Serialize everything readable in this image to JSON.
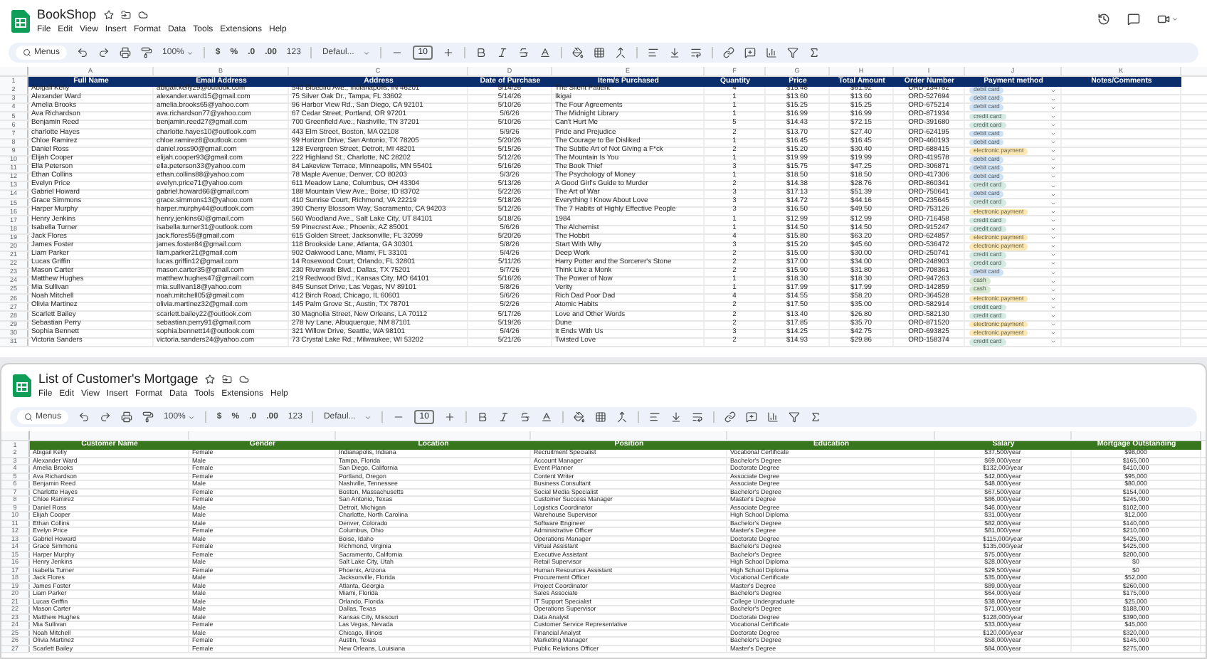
{
  "windows": [
    {
      "title": "BookShop",
      "menu": [
        "File",
        "Edit",
        "View",
        "Insert",
        "Format",
        "Data",
        "Tools",
        "Extensions",
        "Help"
      ],
      "toolbar": {
        "search": "Menus",
        "zoom": "100%",
        "font": "Defaul...",
        "font_size": "10",
        "currency": "$",
        "percent": "%",
        "decrease_decimals": ".0",
        "increase_decimals": ".00",
        "number_format": "123"
      },
      "sheet": {
        "kind": "orders",
        "column_letters": [
          "A",
          "B",
          "C",
          "D",
          "E",
          "F",
          "G",
          "H",
          "I",
          "J",
          "K"
        ],
        "columns": [
          "Full Name",
          "Email Address",
          "Address",
          "Date of Purchase",
          "Item/s Purchased",
          "Quantity",
          "Price",
          "Total Amount",
          "Order Number",
          "Payment method",
          "Notes/Comments"
        ],
        "header_row_number": "1",
        "rows": [
          {
            "row_number": "2",
            "cells": [
              "Abigail Kelly",
              "abigail.kelly29@outlook.com",
              "540 Bluebird Ave., Indianapolis, IN 46201",
              "5/14/26",
              "The Silent Patient",
              "4",
              "$15.48",
              "$61.92",
              "ORD-134782"
            ],
            "payment": {
              "label": "debit card",
              "color": "#cfe2f3"
            }
          },
          {
            "row_number": "3",
            "cells": [
              "Alexander Ward",
              "alexander.ward15@gmail.com",
              "75 Silver Oak Dr., Tampa, FL 33602",
              "5/14/26",
              "Ikigai",
              "1",
              "$13.60",
              "$13.60",
              "ORD-527694"
            ],
            "payment": {
              "label": "debit card",
              "color": "#cfe2f3"
            }
          },
          {
            "row_number": "4",
            "cells": [
              "Amelia Brooks",
              "amelia.brooks65@yahoo.com",
              "96 Harbor View Rd., San Diego, CA 92101",
              "5/10/26",
              "The Four Agreements",
              "1",
              "$15.25",
              "$15.25",
              "ORD-675214"
            ],
            "payment": {
              "label": "debit card",
              "color": "#cfe2f3"
            }
          },
          {
            "row_number": "5",
            "cells": [
              "Ava Richardson",
              "ava.richardson77@yahoo.com",
              "67 Cedar Street, Portland, OR 97201",
              "5/6/26",
              "The Midnight Library",
              "1",
              "$16.99",
              "$16.99",
              "ORD-871934"
            ],
            "payment": {
              "label": "credit card",
              "color": "#d4ebe4"
            }
          },
          {
            "row_number": "6",
            "cells": [
              "Benjamin Reed",
              "benjamin.reed27@gmail.com",
              "700 Greenfield Ave., Nashville, TN 37201",
              "5/10/26",
              "Can't Hurt Me",
              "5",
              "$14.43",
              "$72.15",
              "ORD-391680"
            ],
            "payment": {
              "label": "credit card",
              "color": "#d4ebe4"
            }
          },
          {
            "row_number": "7",
            "cells": [
              "charlotte Hayes",
              "charlotte.hayes10@outlook.com",
              "443 Elm Street, Boston, MA 02108",
              "5/9/26",
              "Pride and Prejudice",
              "2",
              "$13.70",
              "$27.40",
              "ORD-624195"
            ],
            "payment": {
              "label": "debit card",
              "color": "#cfe2f3"
            }
          },
          {
            "row_number": "8",
            "cells": [
              "Chloe Ramirez",
              "chloe.ramirez8@outlook.com",
              "99 Horizon Drive, San Antonio, TX 78205",
              "5/20/26",
              "The Courage to Be Disliked",
              "1",
              "$16.45",
              "$16.45",
              "ORD-460193"
            ],
            "payment": {
              "label": "debit card",
              "color": "#cfe2f3"
            }
          },
          {
            "row_number": "9",
            "cells": [
              "Daniel Ross",
              "daniel.ross90@gmail.com",
              "128 Evergreen Street, Detroit, MI 48201",
              "5/15/26",
              "The Subtle Art of Not Giving a F*ck",
              "2",
              "$15.20",
              "$30.40",
              "ORD-688415"
            ],
            "payment": {
              "label": "electronic payment",
              "color": "#fce8b2"
            }
          },
          {
            "row_number": "10",
            "cells": [
              "Elijah Cooper",
              "elijah.cooper93@gmail.com",
              "222 Highland St., Charlotte, NC 28202",
              "5/12/26",
              "The Mountain Is You",
              "1",
              "$19.99",
              "$19.99",
              "ORD-419578"
            ],
            "payment": {
              "label": "debit card",
              "color": "#cfe2f3"
            }
          },
          {
            "row_number": "11",
            "cells": [
              "Ella Peterson",
              "ella.peterson33@yahoo.com",
              "84 Lakeview Terrace, Minneapolis, MN 55401",
              "5/16/26",
              "The Book Thief",
              "3",
              "$15.75",
              "$47.25",
              "ORD-306871"
            ],
            "payment": {
              "label": "debit card",
              "color": "#cfe2f3"
            }
          },
          {
            "row_number": "12",
            "cells": [
              "Ethan Collins",
              "ethan.collins88@yahoo.com",
              "78 Maple Avenue, Denver, CO 80203",
              "5/3/26",
              "The Psychology of Money",
              "1",
              "$18.50",
              "$18.50",
              "ORD-417306"
            ],
            "payment": {
              "label": "debit card",
              "color": "#cfe2f3"
            }
          },
          {
            "row_number": "13",
            "cells": [
              "Evelyn Price",
              "evelyn.price71@yahoo.com",
              "611 Meadow Lane, Columbus, OH 43304",
              "5/13/26",
              "A Good Girl's Guide to Murder",
              "2",
              "$14.38",
              "$28.76",
              "ORD-860341"
            ],
            "payment": {
              "label": "credit card",
              "color": "#d4ebe4"
            }
          },
          {
            "row_number": "14",
            "cells": [
              "Gabriel Howard",
              "gabriel.howard66@gmail.com",
              "188 Mountain View Ave., Boise, ID 83702",
              "5/22/26",
              "The Art of War",
              "3",
              "$17.13",
              "$51.39",
              "ORD-750641"
            ],
            "payment": {
              "label": "debit card",
              "color": "#cfe2f3"
            }
          },
          {
            "row_number": "15",
            "cells": [
              "Grace Simmons",
              "grace.simmons13@yahoo.com",
              "410 Sunrise Court, Richmond, VA 22219",
              "5/18/26",
              "Everything I Know About Love",
              "3",
              "$14.72",
              "$44.16",
              "ORD-235645"
            ],
            "payment": {
              "label": "credit card",
              "color": "#d4ebe4"
            }
          },
          {
            "row_number": "16",
            "cells": [
              "Harper Murphy",
              "harper.murphy44@outlook.com",
              "390 Cherry Blossom Way, Sacramento, CA 94203",
              "5/12/26",
              "The 7 Habits of Highly Effective People",
              "3",
              "$16.50",
              "$49.50",
              "ORD-753126"
            ],
            "payment": {
              "label": "electronic payment",
              "color": "#fce8b2"
            }
          },
          {
            "row_number": "17",
            "cells": [
              "Henry Jenkins",
              "henry.jenkins60@gmail.com",
              "560 Woodland Ave., Salt Lake City, UT 84101",
              "5/18/26",
              "1984",
              "1",
              "$12.99",
              "$12.99",
              "ORD-716458"
            ],
            "payment": {
              "label": "credit card",
              "color": "#d4ebe4"
            }
          },
          {
            "row_number": "18",
            "cells": [
              "Isabella Turner",
              "isabella.turner31@outlook.com",
              "59 Pinecrest Ave., Phoenix, AZ 85001",
              "5/6/26",
              "The Alchemist",
              "1",
              "$14.50",
              "$14.50",
              "ORD-915247"
            ],
            "payment": {
              "label": "credit card",
              "color": "#d4ebe4"
            }
          },
          {
            "row_number": "19",
            "cells": [
              "Jack Flores",
              "jack.flores55@gmail.com",
              "615 Golden Street, Jacksonville, FL 32099",
              "5/20/26",
              "The Hobbit",
              "4",
              "$15.80",
              "$63.20",
              "ORD-624857"
            ],
            "payment": {
              "label": "electronic payment",
              "color": "#fce8b2"
            }
          },
          {
            "row_number": "20",
            "cells": [
              "James Foster",
              "james.foster84@gmail.com",
              "118 Brookside Lane, Atlanta, GA 30301",
              "5/8/26",
              "Start With Why",
              "3",
              "$15.20",
              "$45.60",
              "ORD-536472"
            ],
            "payment": {
              "label": "electronic payment",
              "color": "#fce8b2"
            }
          },
          {
            "row_number": "21",
            "cells": [
              "Liam Parker",
              "liam.parker21@gmail.com",
              "902 Oakwood Lane, Miami, FL 33101",
              "5/4/26",
              "Deep Work",
              "2",
              "$15.00",
              "$30.00",
              "ORD-250741"
            ],
            "payment": {
              "label": "credit card",
              "color": "#d4ebe4"
            }
          },
          {
            "row_number": "22",
            "cells": [
              "Lucas Griffin",
              "lucas.griffin12@gmail.com",
              "14 Rosewood Court, Orlando, FL 32801",
              "5/11/26",
              "Harry Potter and the Sorcerer's Stone",
              "2",
              "$17.00",
              "$34.00",
              "ORD-248903"
            ],
            "payment": {
              "label": "credit card",
              "color": "#d4ebe4"
            }
          },
          {
            "row_number": "23",
            "cells": [
              "Mason Carter",
              "mason.carter35@gmail.com",
              "230 Riverwalk Blvd., Dallas, TX 75201",
              "5/7/26",
              "Think Like a Monk",
              "2",
              "$15.90",
              "$31.80",
              "ORD-708361"
            ],
            "payment": {
              "label": "debit card",
              "color": "#cfe2f3"
            }
          },
          {
            "row_number": "24",
            "cells": [
              "Matthew Hughes",
              "matthew.hughes47@gmail.com",
              "219 Redwood Blvd., Kansas City, MO 64101",
              "5/16/26",
              "The Power of Now",
              "1",
              "$18.30",
              "$18.30",
              "ORD-947263"
            ],
            "payment": {
              "label": "cash",
              "color": "#d9ead3"
            }
          },
          {
            "row_number": "25",
            "cells": [
              "Mia Sullivan",
              "mia.sullivan18@yahoo.com",
              "845 Sunset Drive, Las Vegas, NV 89101",
              "5/8/26",
              "Verity",
              "1",
              "$17.99",
              "$17.99",
              "ORD-142859"
            ],
            "payment": {
              "label": "cash",
              "color": "#d9ead3"
            }
          },
          {
            "row_number": "26",
            "cells": [
              "Noah Mitchell",
              "noah.mitchell05@gmail.com",
              "412 Birch Road, Chicago, IL 60601",
              "5/6/26",
              "Rich Dad Poor Dad",
              "4",
              "$14.55",
              "$58.20",
              "ORD-364528"
            ],
            "payment": {
              "label": "electronic payment",
              "color": "#fce8b2"
            }
          },
          {
            "row_number": "27",
            "cells": [
              "Olivia Martinez",
              "olivia.martinez32@gmail.com",
              "145 Palm Grove St., Austin, TX 78701",
              "5/2/26",
              "Atomic Habits",
              "2",
              "$17.50",
              "$35.00",
              "ORD-582914"
            ],
            "payment": {
              "label": "credit card",
              "color": "#d4ebe4"
            }
          },
          {
            "row_number": "28",
            "cells": [
              "Scarlett Bailey",
              "scarlett.bailey22@outlook.com",
              "30 Magnolia Street, New Orleans, LA 70112",
              "5/17/26",
              "Love and Other Words",
              "2",
              "$13.40",
              "$26.80",
              "ORD-582130"
            ],
            "payment": {
              "label": "credit card",
              "color": "#d4ebe4"
            }
          },
          {
            "row_number": "29",
            "cells": [
              "Sebastian Perry",
              "sebastian.perry91@gmail.com",
              "278 Ivy Lane, Albuquerque, NM 87101",
              "5/19/26",
              "Dune",
              "2",
              "$17.85",
              "$35.70",
              "ORD-871520"
            ],
            "payment": {
              "label": "electronic payment",
              "color": "#fce8b2"
            }
          },
          {
            "row_number": "30",
            "cells": [
              "Sophia Bennett",
              "sophia.bennett14@outlook.com",
              "321 Willow Drive, Seattle, WA 98101",
              "5/4/26",
              "It Ends With Us",
              "3",
              "$14.25",
              "$42.75",
              "ORD-693825"
            ],
            "payment": {
              "label": "electronic payment",
              "color": "#fce8b2"
            }
          },
          {
            "row_number": "31",
            "cells": [
              "Victoria Sanders",
              "victoria.sanders24@yahoo.com",
              "73 Crystal Lake Rd., Milwaukee, WI 53202",
              "5/21/26",
              "Twisted Love",
              "2",
              "$14.93",
              "$29.86",
              "ORD-158374"
            ],
            "payment": {
              "label": "credit card",
              "color": "#d4ebe4"
            }
          }
        ]
      }
    },
    {
      "title": "List of Customer's Mortgage",
      "menu": [
        "File",
        "Edit",
        "View",
        "Insert",
        "Format",
        "Data",
        "Tools",
        "Extensions",
        "Help"
      ],
      "toolbar": {
        "search": "Menus",
        "zoom": "100%",
        "font": "Defaul...",
        "font_size": "10",
        "currency": "$",
        "percent": "%",
        "decrease_decimals": ".0",
        "increase_decimals": ".00",
        "number_format": "123"
      },
      "sheet": {
        "kind": "mortgage",
        "columns": [
          "Customer Name",
          "Gender",
          "Location",
          "Position",
          "Education",
          "Salary",
          "Mortgage Outstanding"
        ],
        "header_row_number": "1",
        "rows": [
          {
            "row_number": "2",
            "cells": [
              "Abigail Kelly",
              "Female",
              "Indianapolis, Indiana",
              "Recruitment Specialist",
              "Vocational Certificate",
              "$37,500/year",
              "$98,000"
            ]
          },
          {
            "row_number": "3",
            "cells": [
              "Alexander Ward",
              "Male",
              "Tampa, Florida",
              "Account Manager",
              "Bachelor's Degree",
              "$69,000/year",
              "$165,000"
            ]
          },
          {
            "row_number": "4",
            "cells": [
              "Amelia Brooks",
              "Female",
              "San Diego, California",
              "Event Planner",
              "Doctorate Degree",
              "$132,000/year",
              "$410,000"
            ]
          },
          {
            "row_number": "5",
            "cells": [
              "Ava Richardson",
              "Female",
              "Portland, Oregon",
              "Content Writer",
              "Associate Degree",
              "$42,000/year",
              "$95,000"
            ]
          },
          {
            "row_number": "6",
            "cells": [
              "Benjamin Reed",
              "Male",
              "Nashville, Tennessee",
              "Business Consultant",
              "Associate Degree",
              "$48,000/year",
              "$80,000"
            ]
          },
          {
            "row_number": "7",
            "cells": [
              "Charlotte Hayes",
              "Female",
              "Boston, Massachusetts",
              "Social Media Specialist",
              "Bachelor's Degree",
              "$67,500/year",
              "$154,000"
            ]
          },
          {
            "row_number": "8",
            "cells": [
              "Chloe Ramirez",
              "Female",
              "San Antonio, Texas",
              "Customer Success Manager",
              "Master's Degree",
              "$86,000/year",
              "$245,000"
            ]
          },
          {
            "row_number": "9",
            "cells": [
              "Daniel Ross",
              "Male",
              "Detroit, Michigan",
              "Logistics Coordinator",
              "Associate Degree",
              "$46,000/year",
              "$102,000"
            ]
          },
          {
            "row_number": "10",
            "cells": [
              "Elijah Cooper",
              "Male",
              "Charlotte, North Carolina",
              "Warehouse Supervisor",
              "High School Diploma",
              "$31,000/year",
              "$12,000"
            ]
          },
          {
            "row_number": "11",
            "cells": [
              "Ethan Collins",
              "Male",
              "Denver, Colorado",
              "Software Engineer",
              "Bachelor's Degree",
              "$82,000/year",
              "$140,000"
            ]
          },
          {
            "row_number": "12",
            "cells": [
              "Evelyn Price",
              "Female",
              "Columbus, Ohio",
              "Administrative Officer",
              "Master's Degree",
              "$81,000/year",
              "$210,000"
            ]
          },
          {
            "row_number": "13",
            "cells": [
              "Gabriel Howard",
              "Male",
              "Boise, Idaho",
              "Operations Manager",
              "Doctorate Degree",
              "$115,000/year",
              "$425,000"
            ]
          },
          {
            "row_number": "14",
            "cells": [
              "Grace Simmons",
              "Female",
              "Richmond, Virginia",
              "Virtual Assistant",
              "Bachelor's Degree",
              "$135,000/year",
              "$425,000"
            ]
          },
          {
            "row_number": "15",
            "cells": [
              "Harper Murphy",
              "Female",
              "Sacramento, California",
              "Executive Assistant",
              "Bachelor's Degree",
              "$75,000/year",
              "$200,000"
            ]
          },
          {
            "row_number": "16",
            "cells": [
              "Henry Jenkins",
              "Male",
              "Salt Lake City, Utah",
              "Retail Supervisor",
              "High School Diploma",
              "$28,000/year",
              "$0"
            ]
          },
          {
            "row_number": "17",
            "cells": [
              "Isabella Turner",
              "Female",
              "Phoenix, Arizona",
              "Human Resources Assistant",
              "High School Diploma",
              "$29,500/year",
              "$0"
            ]
          },
          {
            "row_number": "18",
            "cells": [
              "Jack Flores",
              "Male",
              "Jacksonville, Florida",
              "Procurement Officer",
              "Vocational Certificate",
              "$35,000/year",
              "$52,000"
            ]
          },
          {
            "row_number": "19",
            "cells": [
              "James Foster",
              "Male",
              "Atlanta, Georgia",
              "Project Coordinator",
              "Master's Degree",
              "$89,000/year",
              "$260,000"
            ]
          },
          {
            "row_number": "20",
            "cells": [
              "Liam Parker",
              "Male",
              "Miami, Florida",
              "Sales Associate",
              "Bachelor's Degree",
              "$64,000/year",
              "$175,000"
            ]
          },
          {
            "row_number": "21",
            "cells": [
              "Lucas Griffin",
              "Male",
              "Orlando, Florida",
              "IT Support Specialist",
              "College Undergraduate",
              "$38,000/year",
              "$25,000"
            ]
          },
          {
            "row_number": "22",
            "cells": [
              "Mason Carter",
              "Male",
              "Dallas, Texas",
              "Operations Supervisor",
              "Bachelor's Degree",
              "$71,000/year",
              "$188,000"
            ]
          },
          {
            "row_number": "23",
            "cells": [
              "Matthew Hughes",
              "Male",
              "Kansas City, Missouri",
              "Data Analyst",
              "Doctorate Degree",
              "$128,000/year",
              "$390,000"
            ]
          },
          {
            "row_number": "24",
            "cells": [
              "Mia Sullivan",
              "Female",
              "Las Vegas, Nevada",
              "Customer Service Representative",
              "Vocational Certificate",
              "$33,000/year",
              "$45,000"
            ]
          },
          {
            "row_number": "25",
            "cells": [
              "Noah Mitchell",
              "Male",
              "Chicago, Illinois",
              "Financial Analyst",
              "Doctorate Degree",
              "$120,000/year",
              "$320,000"
            ]
          },
          {
            "row_number": "26",
            "cells": [
              "Olivia Martinez",
              "Female",
              "Austin, Texas",
              "Marketing Manager",
              "Bachelor's Degree",
              "$58,000/year",
              "$145,000"
            ]
          },
          {
            "row_number": "27",
            "cells": [
              "Scarlett Bailey",
              "Female",
              "New Orleans, Louisiana",
              "Public Relations Officer",
              "Master's Degree",
              "$84,000/year",
              "$275,000"
            ]
          }
        ]
      }
    }
  ]
}
